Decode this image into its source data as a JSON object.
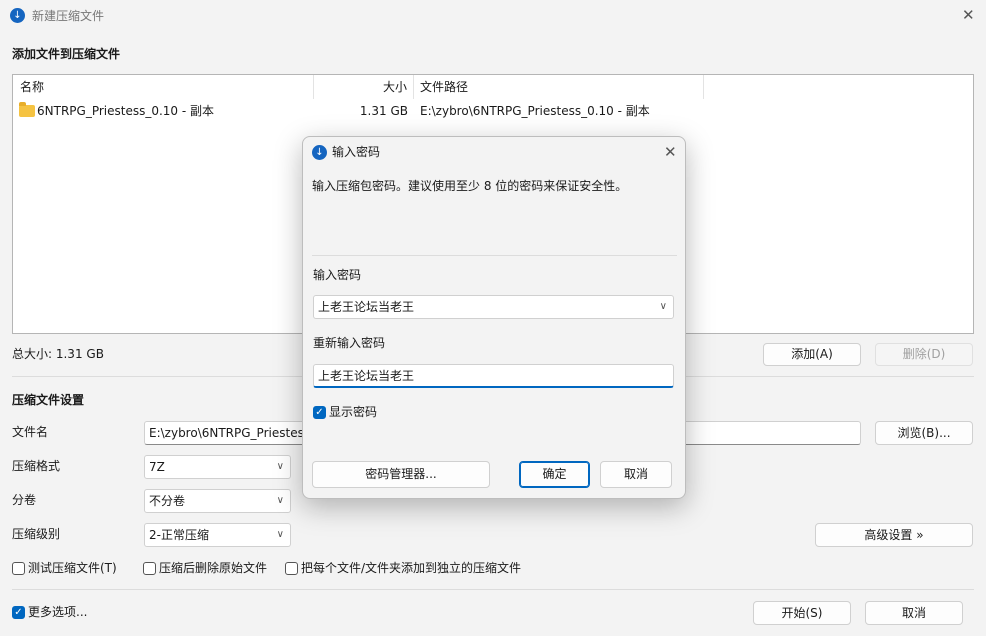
{
  "window": {
    "title": "新建压缩文件",
    "icon": "zip-app-icon"
  },
  "add_section": {
    "title": "添加文件到压缩文件"
  },
  "file_list": {
    "columns": [
      "名称",
      "大小",
      "文件路径"
    ],
    "rows": [
      {
        "name": "6NTRPG_Priestess_0.10 - 副本",
        "size": "1.31 GB",
        "path": "E:\\zybro\\6NTRPG_Priestess_0.10 - 副本"
      }
    ]
  },
  "total_size": "总大小: 1.31 GB",
  "buttons": {
    "add": "添加(A)",
    "delete": "删除(D)",
    "browse": "浏览(B)...",
    "advanced": "高级设置 »",
    "start": "开始(S)",
    "cancel": "取消"
  },
  "settings": {
    "title": "压缩文件设置",
    "filename_label": "文件名",
    "filename_value": "E:\\zybro\\6NTRPG_Priestess",
    "format_label": "压缩格式",
    "format_value": "7Z",
    "split_label": "分卷",
    "split_value": "不分卷",
    "level_label": "压缩级别",
    "level_value": "2-正常压缩"
  },
  "options": {
    "test": "测试压缩文件(T)",
    "delete_after": "压缩后删除原始文件",
    "separate": "把每个文件/文件夹添加到独立的压缩文件",
    "more": "更多选项..."
  },
  "dialog": {
    "title": "输入密码",
    "hint": "输入压缩包密码。建议使用至少 8 位的密码来保证安全性。",
    "password_label": "输入密码",
    "password_value": "上老王论坛当老王",
    "reenter_label": "重新输入密码",
    "reenter_value": "上老王论坛当老王",
    "show_password": "显示密码",
    "manager_button": "密码管理器...",
    "ok_button": "确定",
    "cancel_button": "取消"
  },
  "colors": {
    "accent": "#0067c0",
    "folder": "#f5c342"
  }
}
